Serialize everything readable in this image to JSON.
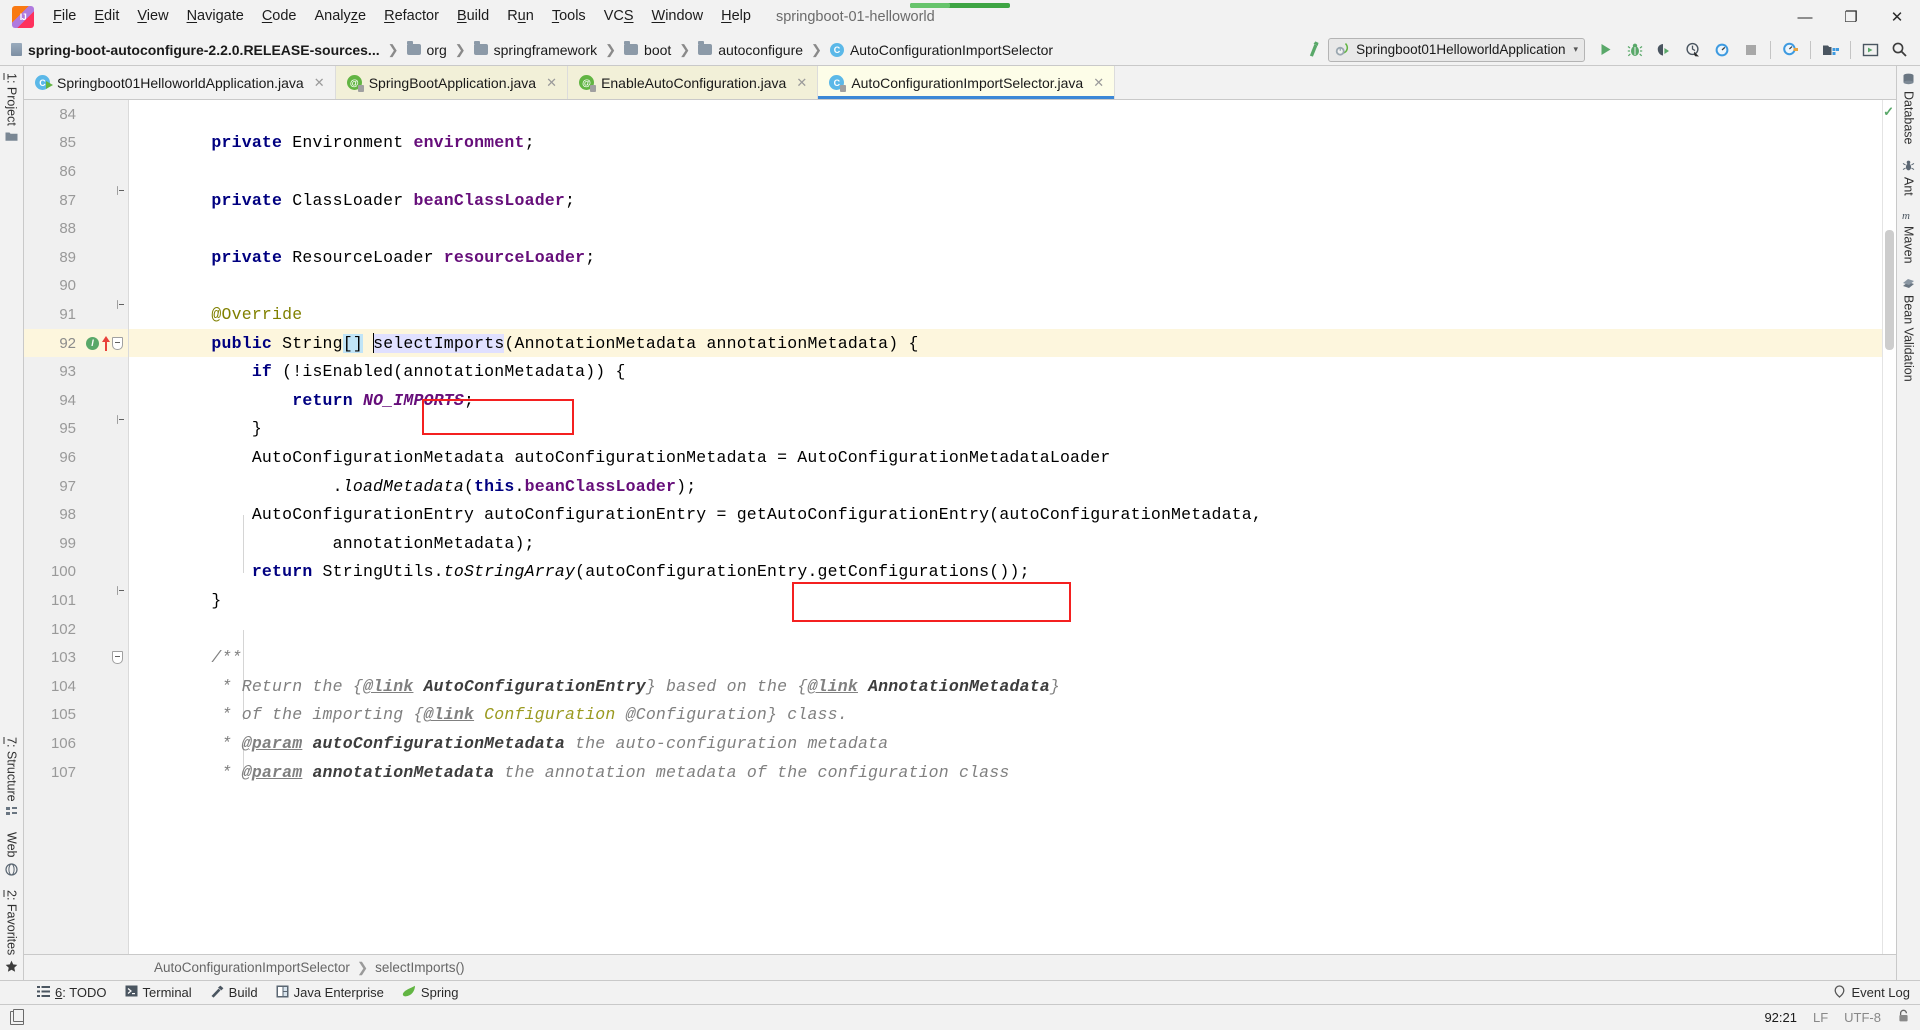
{
  "window": {
    "logo": "intellij-logo",
    "project_title": "springboot-01-helloworld",
    "minimize": "—",
    "maximize": "❐",
    "close": "✕"
  },
  "menu": [
    {
      "label": "File",
      "mnemonic": "F"
    },
    {
      "label": "Edit",
      "mnemonic": "E"
    },
    {
      "label": "View",
      "mnemonic": "V"
    },
    {
      "label": "Navigate",
      "mnemonic": "N"
    },
    {
      "label": "Code",
      "mnemonic": "C"
    },
    {
      "label": "Analyze",
      "mnemonic": "z"
    },
    {
      "label": "Refactor",
      "mnemonic": "R"
    },
    {
      "label": "Build",
      "mnemonic": "B"
    },
    {
      "label": "Run",
      "mnemonic": "u"
    },
    {
      "label": "Tools",
      "mnemonic": "T"
    },
    {
      "label": "VCS",
      "mnemonic": "S"
    },
    {
      "label": "Window",
      "mnemonic": "W"
    },
    {
      "label": "Help",
      "mnemonic": "H"
    }
  ],
  "breadcrumb_top": [
    {
      "label": "spring-boot-autoconfigure-2.2.0.RELEASE-sources...",
      "icon": "module-icon",
      "bold": true
    },
    {
      "label": "org",
      "icon": "folder-icon",
      "bold": false
    },
    {
      "label": "springframework",
      "icon": "folder-icon",
      "bold": false
    },
    {
      "label": "boot",
      "icon": "folder-icon",
      "bold": false
    },
    {
      "label": "autoconfigure",
      "icon": "folder-icon",
      "bold": false
    },
    {
      "label": "AutoConfigurationImportSelector",
      "icon": "class-icon",
      "bold": false
    }
  ],
  "toolbar": {
    "make_project_label": "make-project",
    "run_config": {
      "name": "Springboot01HelloworldApplication",
      "icon": "spring-boot-run-icon",
      "dropdown_arrow": "⌄"
    },
    "buttons": [
      {
        "name": "run-button",
        "icon": "play-icon"
      },
      {
        "name": "debug-button",
        "icon": "bug-icon"
      },
      {
        "name": "run-with-coverage-button",
        "icon": "coverage-icon"
      },
      {
        "name": "profile-button",
        "icon": "clock-arrow-icon"
      },
      {
        "name": "run-dashboard-button",
        "icon": "gauge-icon"
      },
      {
        "name": "stop-button",
        "icon": "stop-icon"
      },
      {
        "name": "attach-profiler-button",
        "icon": "gauge-plug-icon"
      },
      {
        "name": "project-structure-button",
        "icon": "project-structure-icon"
      },
      {
        "name": "update-running-app-button",
        "icon": "update-app-icon"
      },
      {
        "name": "search-everywhere-button",
        "icon": "search-icon"
      }
    ]
  },
  "tabs": [
    {
      "label": "Springboot01HelloworldApplication.java",
      "icon": "class-run-icon",
      "icon_kind": "cls",
      "active": false,
      "cream": false,
      "close": "✕"
    },
    {
      "label": "SpringBootApplication.java",
      "icon": "annotation-icon",
      "icon_kind": "ann",
      "active": false,
      "cream": true,
      "close": "✕"
    },
    {
      "label": "EnableAutoConfiguration.java",
      "icon": "annotation-icon",
      "icon_kind": "ann",
      "active": false,
      "cream": true,
      "close": "✕"
    },
    {
      "label": "AutoConfigurationImportSelector.java",
      "icon": "class-icon",
      "icon_kind": "cls",
      "active": true,
      "cream": false,
      "close": "✕"
    }
  ],
  "left_rail": [
    {
      "label": "1: Project",
      "mnemonic": "1",
      "icon": "folder-icon"
    },
    {
      "label": "7: Structure",
      "mnemonic": "7",
      "icon": "structure-icon"
    },
    {
      "label": "Web",
      "mnemonic": "",
      "icon": "web-icon"
    },
    {
      "label": "2: Favorites",
      "mnemonic": "2",
      "icon": "star-icon"
    }
  ],
  "right_rail": [
    {
      "label": "Database",
      "icon": "database-icon"
    },
    {
      "label": "Ant",
      "icon": "ant-icon"
    },
    {
      "label": "Maven",
      "icon": "maven-icon"
    },
    {
      "label": "Bean Validation",
      "icon": "bean-validation-icon"
    }
  ],
  "editor": {
    "first_line": 84,
    "inspection_status": "ok",
    "lines": [
      {
        "n": 84,
        "tokens": [],
        "gutter": null,
        "fold": null
      },
      {
        "n": 85,
        "tokens": [
          {
            "t": "    ",
            "c": "pln"
          },
          {
            "t": "private",
            "c": "kw"
          },
          {
            "t": " Environment ",
            "c": "pln"
          },
          {
            "t": "environment",
            "c": "fld"
          },
          {
            "t": ";",
            "c": "pln"
          }
        ]
      },
      {
        "n": 86,
        "tokens": []
      },
      {
        "n": 87,
        "tokens": [
          {
            "t": "    ",
            "c": "pln"
          },
          {
            "t": "private",
            "c": "kw"
          },
          {
            "t": " ClassLoader ",
            "c": "pln"
          },
          {
            "t": "beanClassLoader",
            "c": "fld"
          },
          {
            "t": ";",
            "c": "pln"
          }
        ]
      },
      {
        "n": 88,
        "tokens": []
      },
      {
        "n": 89,
        "tokens": [
          {
            "t": "    ",
            "c": "pln"
          },
          {
            "t": "private",
            "c": "kw"
          },
          {
            "t": " ResourceLoader ",
            "c": "pln"
          },
          {
            "t": "resourceLoader",
            "c": "fld"
          },
          {
            "t": ";",
            "c": "pln"
          }
        ]
      },
      {
        "n": 90,
        "tokens": []
      },
      {
        "n": 91,
        "tokens": [
          {
            "t": "    ",
            "c": "pln"
          },
          {
            "t": "@Override",
            "c": "ann2"
          }
        ]
      },
      {
        "n": 92,
        "tokens": [],
        "highlight": true
      },
      {
        "n": 93,
        "tokens": [
          {
            "t": "        ",
            "c": "pln"
          },
          {
            "t": "if",
            "c": "kw"
          },
          {
            "t": " (!isEnabled(annotationMetadata)) {",
            "c": "pln"
          }
        ]
      },
      {
        "n": 94,
        "tokens": [
          {
            "t": "            ",
            "c": "pln"
          },
          {
            "t": "return",
            "c": "kw"
          },
          {
            "t": " ",
            "c": "pln"
          },
          {
            "t": "NO_IMPORTS",
            "c": "sfld"
          },
          {
            "t": ";",
            "c": "pln"
          }
        ]
      },
      {
        "n": 95,
        "tokens": [
          {
            "t": "        }",
            "c": "pln"
          }
        ]
      },
      {
        "n": 96,
        "tokens": [
          {
            "t": "        AutoConfigurationMetadata autoConfigurationMetadata = AutoConfigurationMetadataLoader",
            "c": "pln"
          }
        ]
      },
      {
        "n": 97,
        "tokens": [
          {
            "t": "                .",
            "c": "pln"
          },
          {
            "t": "loadMetadata",
            "c": "sm"
          },
          {
            "t": "(",
            "c": "pln"
          },
          {
            "t": "this",
            "c": "kw"
          },
          {
            "t": ".",
            "c": "pln"
          },
          {
            "t": "beanClassLoader",
            "c": "fld"
          },
          {
            "t": ");",
            "c": "pln"
          }
        ]
      },
      {
        "n": 98,
        "tokens": [
          {
            "t": "        AutoConfigurationEntry autoConfigurationEntry = getAutoConfigurationEntry(autoConfigurationMetadata,",
            "c": "pln"
          }
        ]
      },
      {
        "n": 99,
        "tokens": [
          {
            "t": "                annotationMetadata);",
            "c": "pln"
          }
        ]
      },
      {
        "n": 100,
        "tokens": [
          {
            "t": "        ",
            "c": "pln"
          },
          {
            "t": "return",
            "c": "kw"
          },
          {
            "t": " StringUtils.",
            "c": "pln"
          },
          {
            "t": "toStringArray",
            "c": "sm"
          },
          {
            "t": "(autoConfigurationEntry.getConfigurations());",
            "c": "pln"
          }
        ]
      },
      {
        "n": 101,
        "tokens": [
          {
            "t": "    }",
            "c": "pln"
          }
        ]
      },
      {
        "n": 102,
        "tokens": []
      },
      {
        "n": 103,
        "tokens": [
          {
            "t": "    ",
            "c": "pln"
          },
          {
            "t": "/**",
            "c": "cmt"
          }
        ]
      },
      {
        "n": 104,
        "tokens": [
          {
            "t": "     * Return the {",
            "c": "cmt"
          },
          {
            "t": "@link",
            "c": "cmt-tag"
          },
          {
            "t": " ",
            "c": "cmt"
          },
          {
            "t": "AutoConfigurationEntry",
            "c": "cmt-ref"
          },
          {
            "t": "} based on the {",
            "c": "cmt"
          },
          {
            "t": "@link",
            "c": "cmt-tag"
          },
          {
            "t": " ",
            "c": "cmt"
          },
          {
            "t": "AnnotationMetadata",
            "c": "cmt-ref"
          },
          {
            "t": "}",
            "c": "cmt"
          }
        ]
      },
      {
        "n": 105,
        "tokens": [
          {
            "t": "     * of the importing {",
            "c": "cmt"
          },
          {
            "t": "@link",
            "c": "cmt-tag"
          },
          {
            "t": " ",
            "c": "cmt"
          },
          {
            "t": "Configuration",
            "c": "cmt-ann"
          },
          {
            "t": " ",
            "c": "cmt"
          },
          {
            "t": "@Configuration",
            "c": "cmt"
          },
          {
            "t": "} class.",
            "c": "cmt"
          }
        ]
      },
      {
        "n": 106,
        "tokens": [
          {
            "t": "     * ",
            "c": "cmt"
          },
          {
            "t": "@param",
            "c": "cmt-tag"
          },
          {
            "t": " ",
            "c": "cmt"
          },
          {
            "t": "autoConfigurationMetadata",
            "c": "cmt-ref"
          },
          {
            "t": " the auto-configuration metadata",
            "c": "cmt"
          }
        ]
      },
      {
        "n": 107,
        "tokens": [
          {
            "t": "     * ",
            "c": "cmt"
          },
          {
            "t": "@param",
            "c": "cmt-tag"
          },
          {
            "t": " ",
            "c": "cmt"
          },
          {
            "t": "annotationMetadata",
            "c": "cmt-ref"
          },
          {
            "t": " the annotation metadata of the configuration class",
            "c": "cmt"
          }
        ]
      }
    ],
    "line92": {
      "indent": "    ",
      "kw_public": "public",
      "type": " String",
      "brackets": "[]",
      "space": " ",
      "method": "selectImports",
      "rest": "(AnnotationMetadata annotationMetadata) {",
      "gutter_impl": "I",
      "gutter_override": "override-arrow"
    }
  },
  "breadcrumb_bottom": [
    {
      "label": "AutoConfigurationImportSelector"
    },
    {
      "label": "selectImports()"
    }
  ],
  "tool_windows": [
    {
      "label": "6: TODO",
      "mnemonic": "6",
      "icon": "todo-icon"
    },
    {
      "label": "Terminal",
      "mnemonic": "",
      "icon": "terminal-icon"
    },
    {
      "label": "Build",
      "mnemonic": "",
      "icon": "hammer-icon"
    },
    {
      "label": "Java Enterprise",
      "mnemonic": "",
      "icon": "java-ee-icon"
    },
    {
      "label": "Spring",
      "mnemonic": "",
      "icon": "spring-leaf-icon"
    }
  ],
  "event_log": {
    "label": "Event Log",
    "icon": "balloon-icon"
  },
  "status_bar": {
    "position": "92:21",
    "line_separator": "LF",
    "encoding": "UTF-8",
    "lock_icon": "unlocked-icon",
    "left_icon": "corner-icon"
  },
  "colors": {
    "accent_blue": "#3b87d6",
    "red_box": "#f42020",
    "keyword": "#000080",
    "field": "#660e7a",
    "comment": "#808080",
    "annotation": "#808000",
    "highlight_row": "#fdf6dd",
    "tab_cream": "#f2f0d8",
    "tab_active": "#fdfde8",
    "green": "#59a869"
  }
}
